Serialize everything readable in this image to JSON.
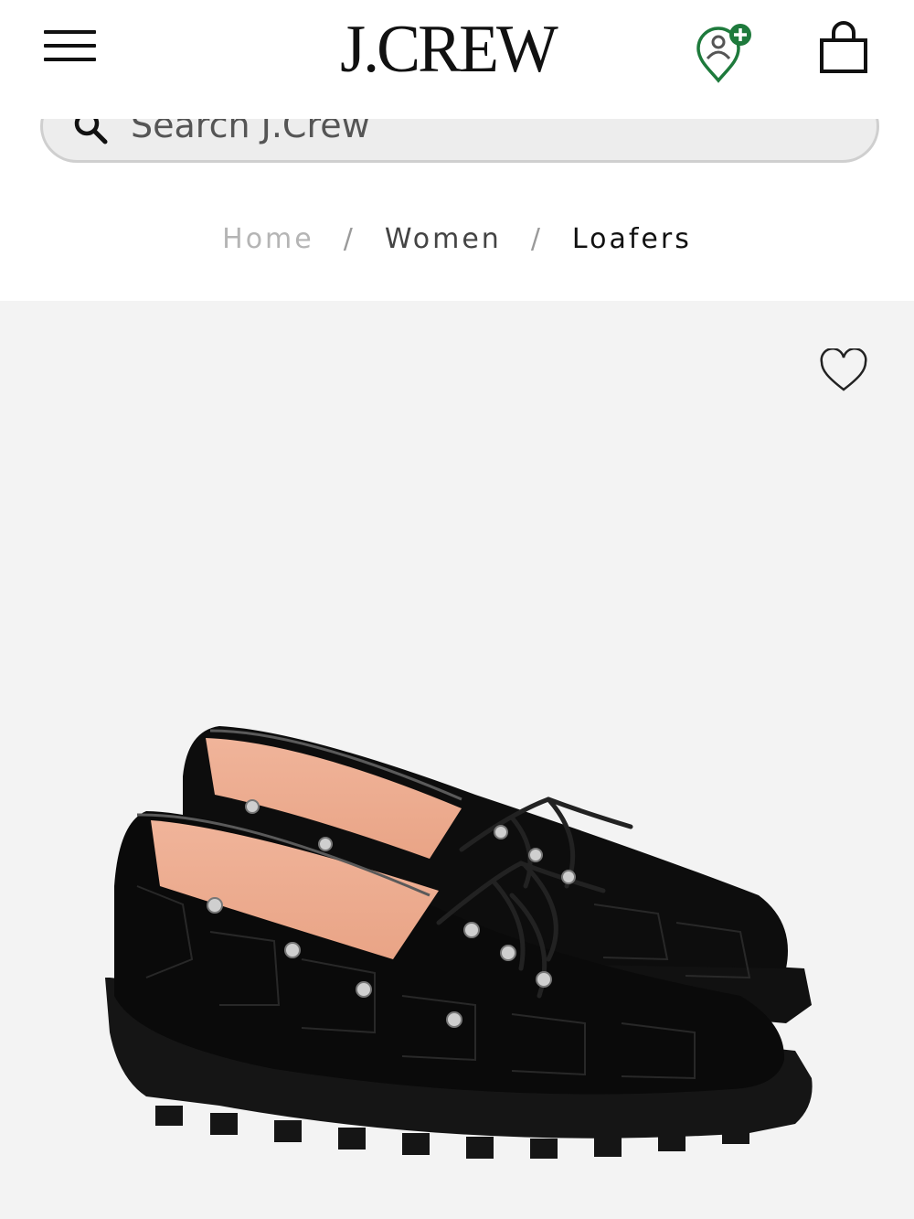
{
  "header": {
    "brand": "J.CREW",
    "icons": {
      "menu": "hamburger-menu-icon",
      "location": "store-locator-pin-icon",
      "bag": "shopping-bag-icon"
    },
    "accent_color": "#1e7a3c"
  },
  "search": {
    "placeholder": "Search J.Crew",
    "value": ""
  },
  "breadcrumb": {
    "items": [
      "Home",
      "Women",
      "Loafers"
    ],
    "separator": "/"
  },
  "product_image": {
    "alt": "Black croc-embossed lug-sole boat shoe loafers",
    "wishlist_icon": "heart-outline-icon"
  }
}
